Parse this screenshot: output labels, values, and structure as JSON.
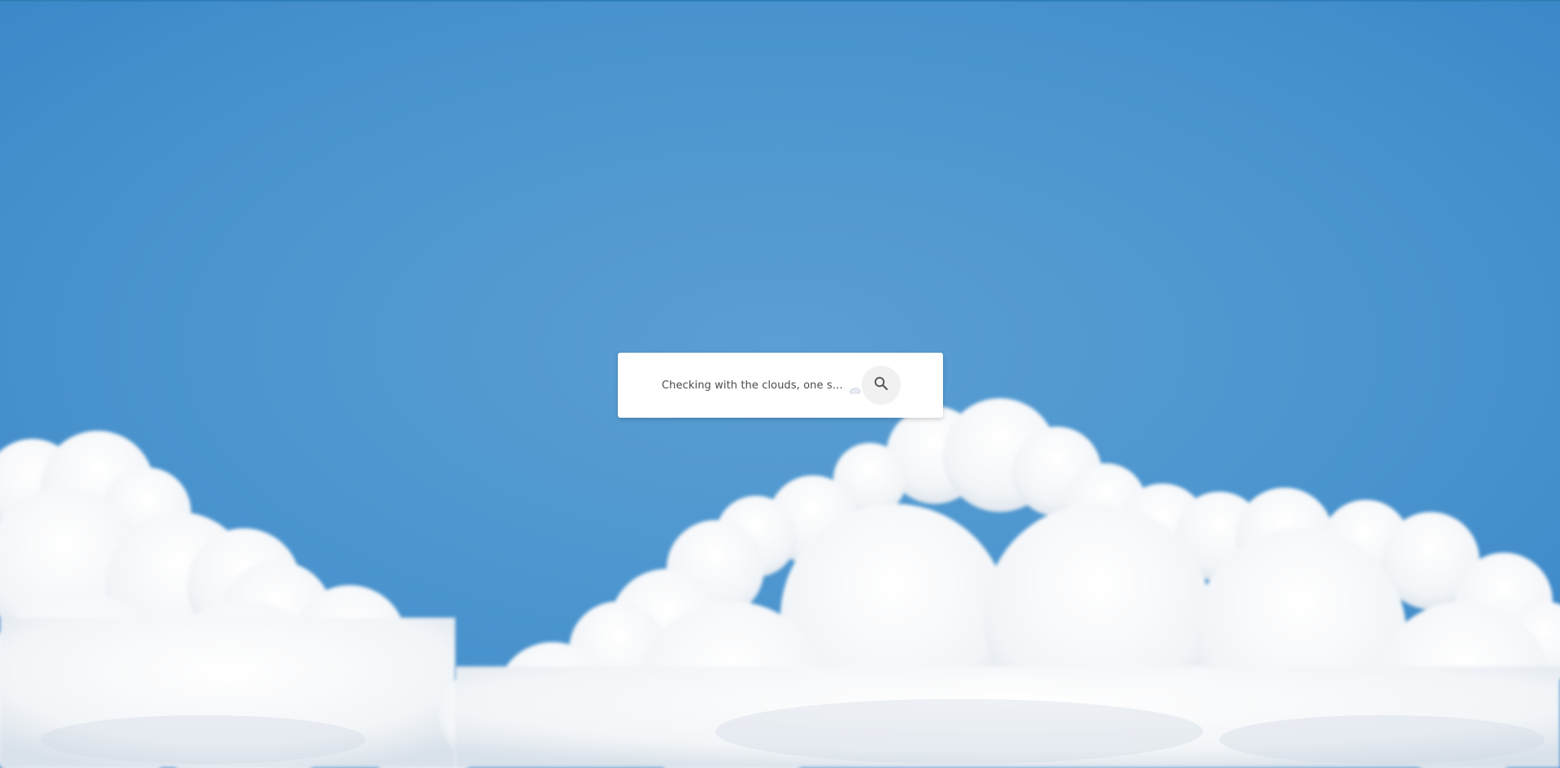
{
  "page": {
    "background_colors": {
      "sky_top": "#3d8dcc",
      "sky_mid": "#5a9fd3",
      "sky_bottom": "#3f8fcf",
      "cloud": "#ffffff",
      "cloud_shadow": "#dfe5ec"
    }
  },
  "search": {
    "status_text": "Checking with the clouds, one sec...",
    "status_icon": "cloud-icon",
    "button_icon": "search-icon",
    "button_bg": "#f1f1f1",
    "card_bg": "#ffffff"
  }
}
